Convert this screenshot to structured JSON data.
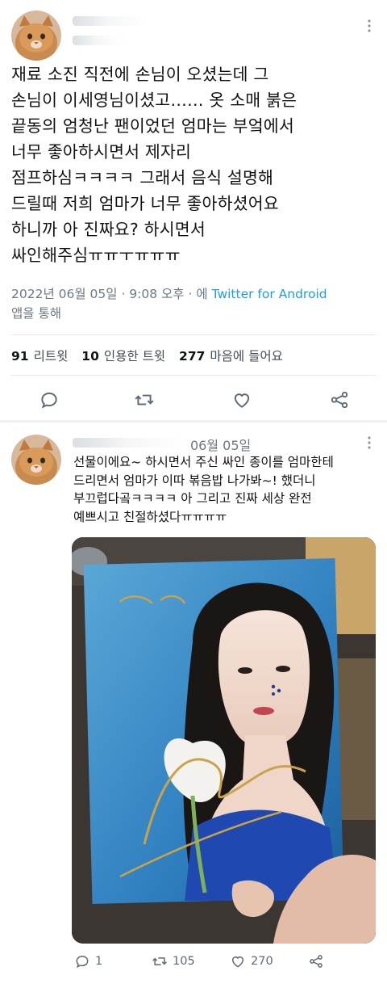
{
  "tweet": {
    "text_lines": [
      "재료 소진 직전에 손님이 오셨는데 그",
      "손님이 이세영님이셨고…… 옷 소매 붉은",
      "끝동의 엄청난 팬이었던 엄마는 부엌에서",
      "너무 좋아하시면서 제자리",
      "점프하심ㅋㅋㅋㅋ 그래서 음식 설명해",
      "드릴때 저희 엄마가 너무 좋아하셨어요",
      "하니까 아 진짜요? 하시면서",
      "싸인해주심ㅠㅠㅜㅠㅠㅠ"
    ],
    "meta_date": "2022년 06월 05일 · 9:08 오후 · 에",
    "meta_source": "Twitter for Android",
    "meta_suffix": "앱을 통해",
    "stats": {
      "retweets_count": "91",
      "retweets_label": "리트윗",
      "quotes_count": "10",
      "quotes_label": "인용한 트윗",
      "likes_count": "277",
      "likes_label": "마음에 들어요"
    }
  },
  "reply": {
    "date": "06월 05일",
    "text_lines": [
      "선물이에요~ 하시면서 주신 싸인 종이를 엄마한테",
      "드리면서 엄마가 이따 볶음밥 나가봐~! 했더니",
      "부끄럽다곸ㅋㅋㅋㅋ 아 그리고 진짜 세상 완전",
      "예쁘시고 친절하셨다ㅠㅠㅠㅠ"
    ],
    "actions": {
      "replies": "1",
      "retweets": "105",
      "likes": "270"
    }
  },
  "colors": {
    "accent": "#1d9bf0",
    "muted": "#6b7785",
    "text": "#0f1419"
  }
}
